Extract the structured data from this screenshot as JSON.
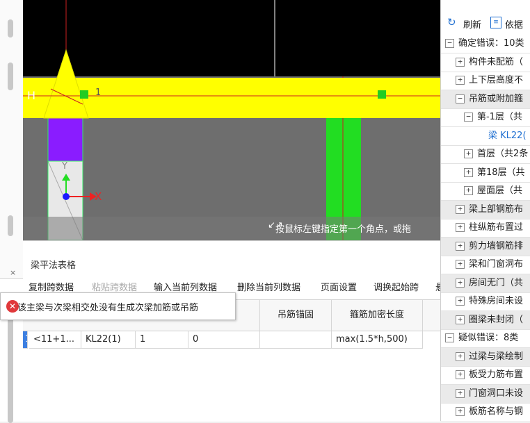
{
  "canvas": {
    "left_label": "H",
    "axis_x": "X",
    "axis_y": "Y",
    "beam_text": "1",
    "colors": {
      "beam": "#ffff00",
      "purple": "#8a1cff",
      "green": "#22dd22",
      "gray": "#6e6e6e"
    },
    "status_text": "按鼠标左键指定第一个角点，或拖"
  },
  "table_panel": {
    "title": "梁平法表格",
    "toolbar": [
      "复制跨数据",
      "粘贴跨数据",
      "输入当前列数据",
      "删除当前列数据",
      "页面设置",
      "调换起始跨",
      "悬"
    ],
    "headers": [
      "吊筋锚固",
      "箍筋加密长度"
    ],
    "row": {
      "index": "1",
      "cells": [
        "<11+1...",
        "KL22(1)",
        "1",
        "0",
        "",
        "max(1.5*h,500)"
      ]
    }
  },
  "tooltip": {
    "icon": "error-icon",
    "text": "该主梁与次梁相交处没有生成次梁加筋或吊筋"
  },
  "left_frame": {
    "close_label": "×"
  },
  "right_panel": {
    "toolbar": {
      "refresh": "刷新",
      "basis": "依据"
    },
    "tree": [
      {
        "toggle": "−",
        "label": "确定错误：10类",
        "level": 0
      },
      {
        "toggle": "+",
        "label": "构件未配筋（",
        "level": 1
      },
      {
        "toggle": "+",
        "label": "上下层高度不",
        "level": 1
      },
      {
        "toggle": "−",
        "label": "吊筋或附加箍",
        "level": 1
      },
      {
        "toggle": "−",
        "label": "第-1层（共",
        "level": 2
      },
      {
        "toggle": "",
        "label": "梁 KL22(",
        "level": 3
      },
      {
        "toggle": "+",
        "label": "首层（共2条",
        "level": 2
      },
      {
        "toggle": "+",
        "label": "第18层（共",
        "level": 2
      },
      {
        "toggle": "+",
        "label": "屋面层（共",
        "level": 2
      },
      {
        "toggle": "+",
        "label": "梁上部钢筋布",
        "level": 1
      },
      {
        "toggle": "+",
        "label": "柱纵筋布置过",
        "level": 1
      },
      {
        "toggle": "+",
        "label": "剪力墙钢筋排",
        "level": 1
      },
      {
        "toggle": "+",
        "label": "梁和门窗洞布",
        "level": 1
      },
      {
        "toggle": "+",
        "label": "房间无门（共",
        "level": 1
      },
      {
        "toggle": "+",
        "label": "特殊房间未设",
        "level": 1
      },
      {
        "toggle": "+",
        "label": "圈梁未封闭（",
        "level": 1
      },
      {
        "toggle": "−",
        "label": "疑似错误：8类",
        "level": 0
      },
      {
        "toggle": "+",
        "label": "过梁与梁绘制",
        "level": 1
      },
      {
        "toggle": "+",
        "label": "板受力筋布置",
        "level": 1
      },
      {
        "toggle": "+",
        "label": "门窗洞口未设",
        "level": 1
      },
      {
        "toggle": "+",
        "label": "板筋名称与钢",
        "level": 1
      }
    ]
  }
}
